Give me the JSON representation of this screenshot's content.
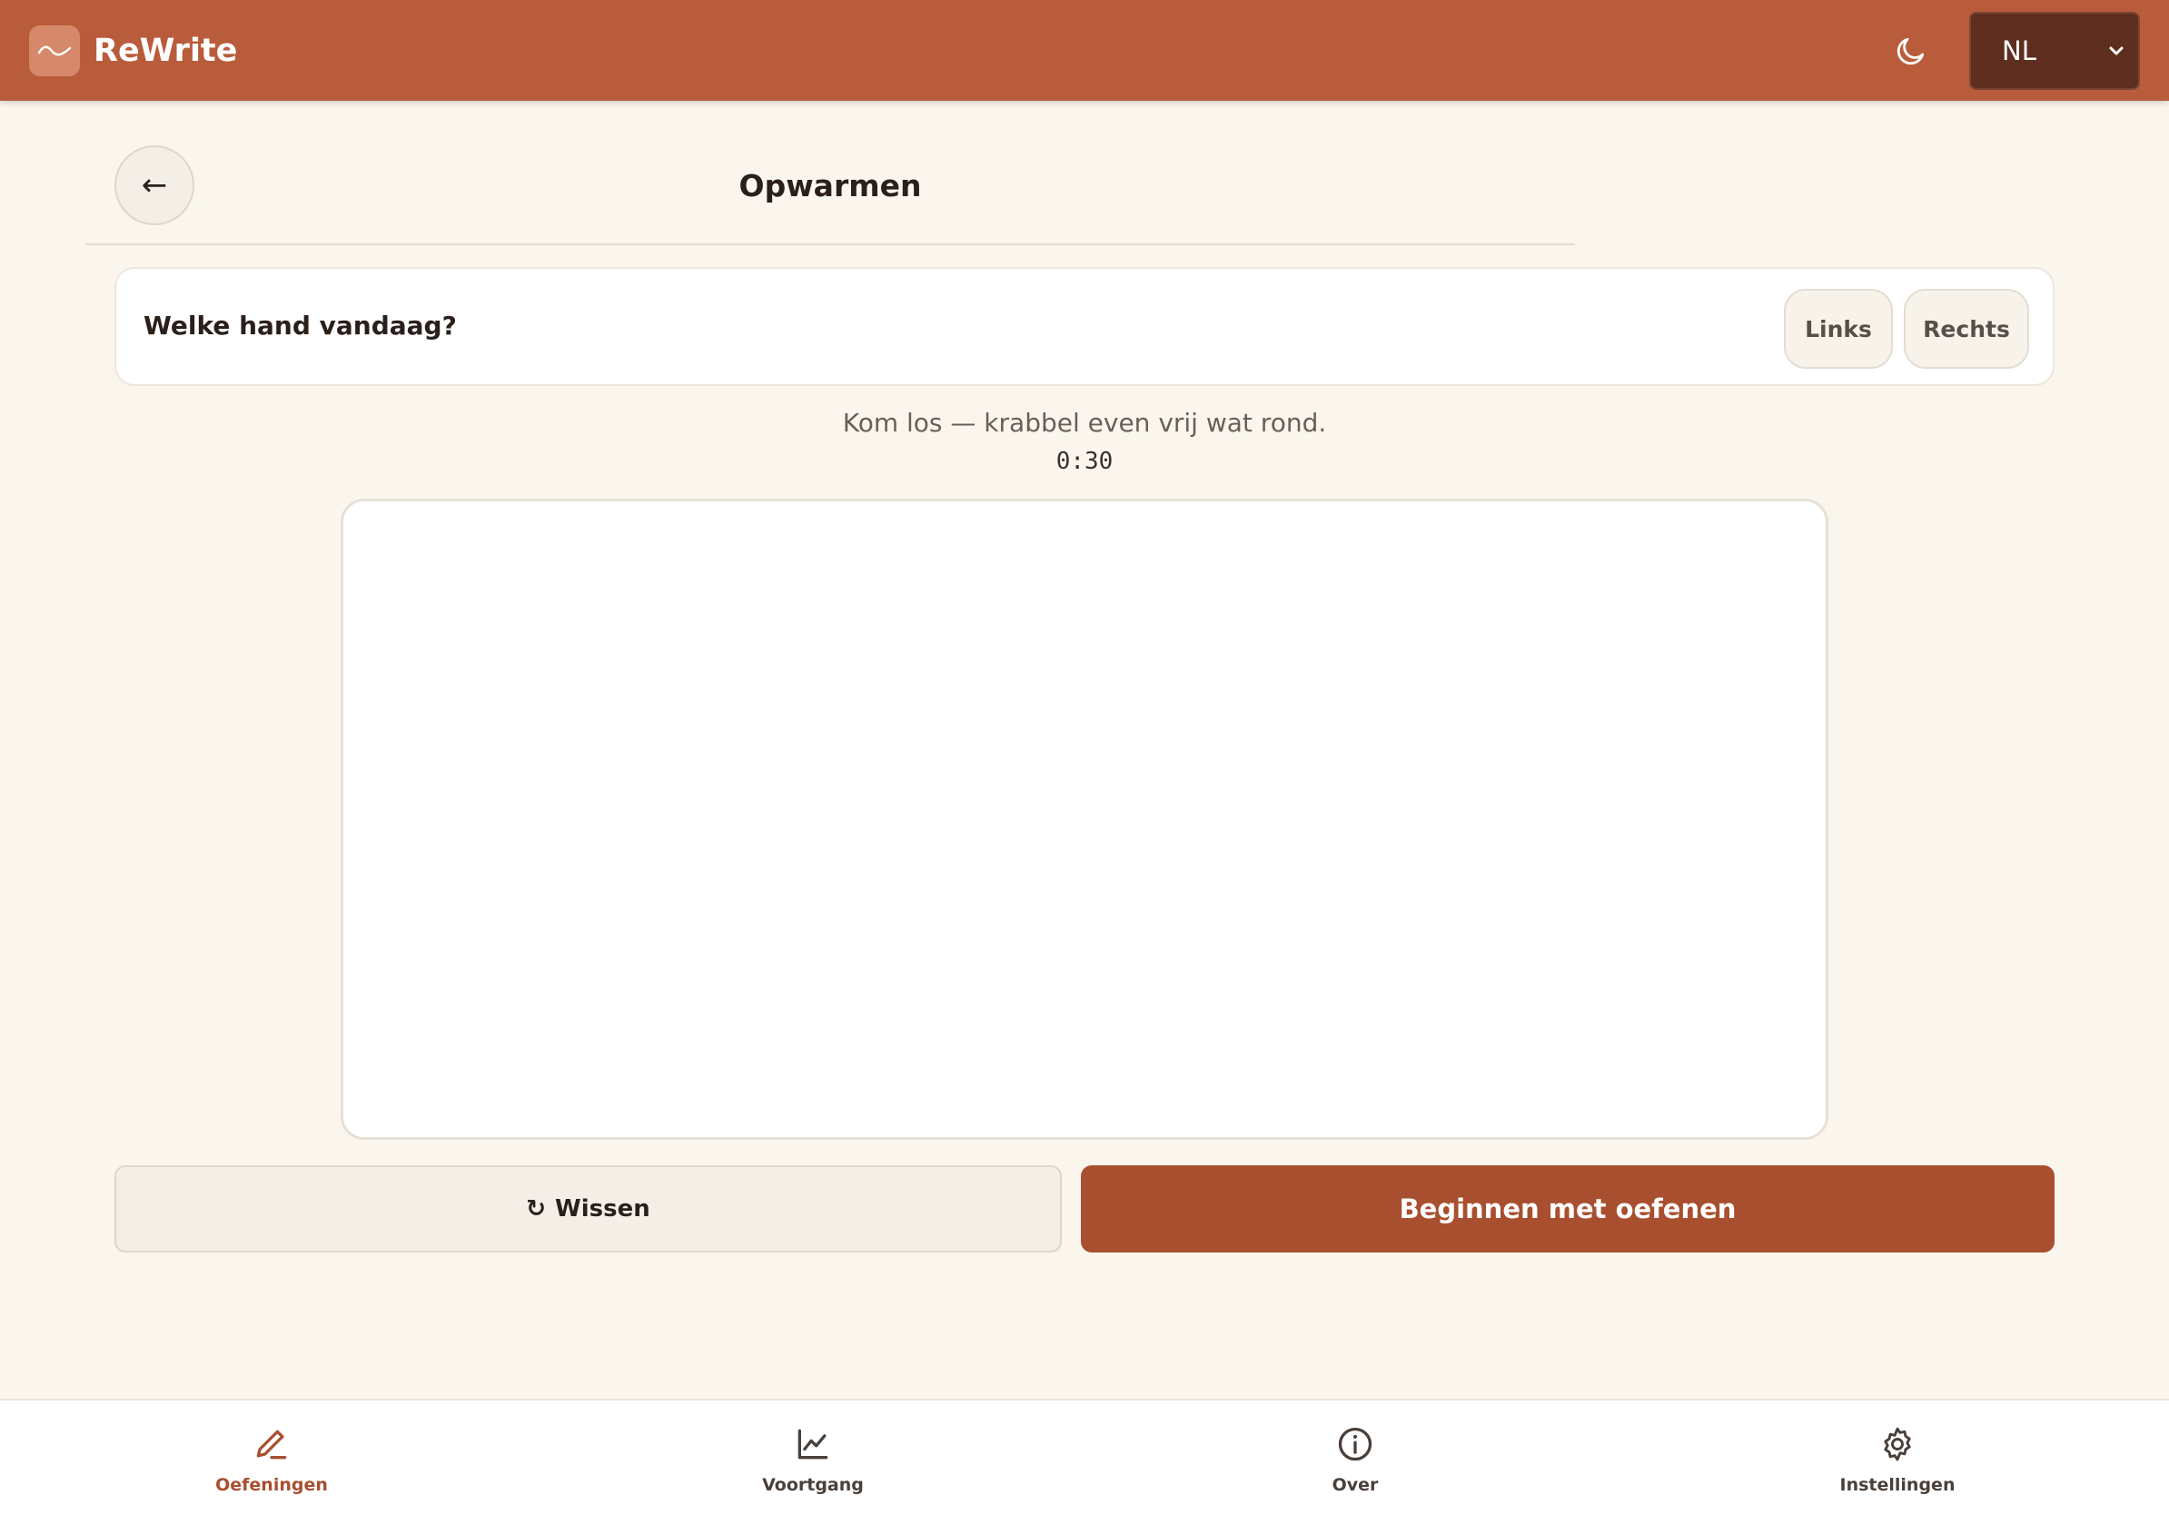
{
  "app": {
    "title": "ReWrite",
    "theme_icon": "moon-icon",
    "language": {
      "selected": "NL"
    }
  },
  "header": {
    "page_title": "Opwarmen",
    "back_label": "←"
  },
  "hand_selector": {
    "question": "Welke hand vandaag?",
    "options": [
      "Links",
      "Rechts"
    ]
  },
  "exercise": {
    "instruction": "Kom los — krabbel even vrij wat rond.",
    "timer": "0:30"
  },
  "actions": {
    "clear_icon": "↻",
    "clear_label": "Wissen",
    "start_label": "Beginnen met oefenen"
  },
  "nav": {
    "items": [
      {
        "label": "Oefeningen",
        "icon": "pencil-icon",
        "active": true
      },
      {
        "label": "Voortgang",
        "icon": "chart-icon",
        "active": false
      },
      {
        "label": "Over",
        "icon": "info-icon",
        "active": false
      },
      {
        "label": "Instellingen",
        "icon": "gear-icon",
        "active": false
      }
    ]
  },
  "colors": {
    "header": "#B95C3B",
    "accent": "#A84F2F",
    "background": "#FAF6EE",
    "language_select": "#5E2E1E"
  }
}
